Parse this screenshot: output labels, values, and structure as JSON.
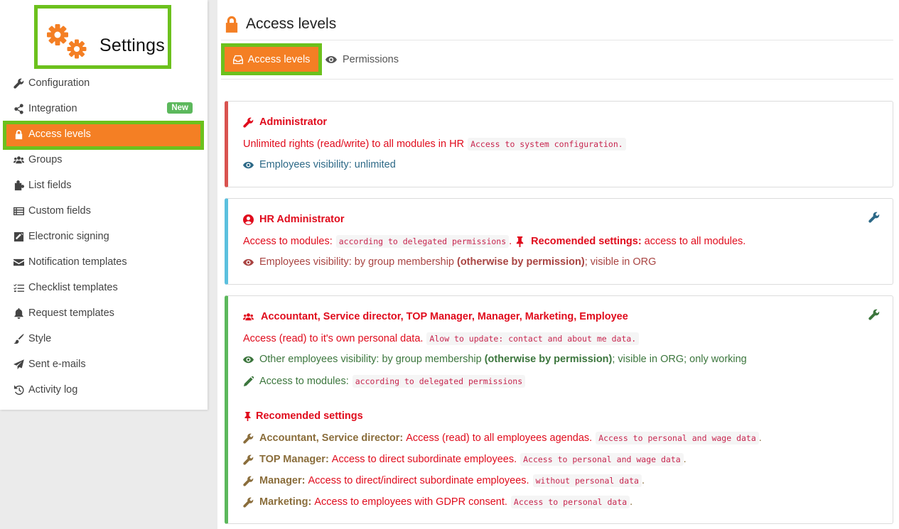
{
  "sidebar": {
    "title": "Settings",
    "items": [
      {
        "label": "Configuration",
        "icon": "wrench-icon"
      },
      {
        "label": "Integration",
        "icon": "share-icon",
        "badge": "New"
      },
      {
        "label": "Access levels",
        "icon": "lock-icon",
        "active": true
      },
      {
        "label": "Groups",
        "icon": "users-icon"
      },
      {
        "label": "List fields",
        "icon": "puzzle-icon"
      },
      {
        "label": "Custom fields",
        "icon": "list-icon"
      },
      {
        "label": "Electronic signing",
        "icon": "signature-icon"
      },
      {
        "label": "Notification templates",
        "icon": "envelope-icon"
      },
      {
        "label": "Checklist templates",
        "icon": "checklist-icon"
      },
      {
        "label": "Request templates",
        "icon": "bell-icon"
      },
      {
        "label": "Style",
        "icon": "brush-icon"
      },
      {
        "label": "Sent e-mails",
        "icon": "paper-plane-icon"
      },
      {
        "label": "Activity log",
        "icon": "history-icon"
      }
    ]
  },
  "page": {
    "title": "Access levels",
    "tabs": [
      {
        "label": "Access levels",
        "icon": "inbox-icon",
        "active": true
      },
      {
        "label": "Permissions",
        "icon": "eye-icon"
      }
    ]
  },
  "cards": {
    "admin": {
      "title": "Administrator",
      "rights": "Unlimited rights (read/write) to all modules in HR",
      "rights_code": "Access to system configuration.",
      "visibility": "Employees visibility: unlimited"
    },
    "hr": {
      "title": "HR Administrator",
      "modules_label": "Access to modules:",
      "modules_code": "according to delegated permissions",
      "modules_sep": ".",
      "rec_label": "Recomended settings:",
      "rec_text": "access to all modules.",
      "vis_text": "Employees visibility: by group membership",
      "vis_bold": "(otherwise by permission)",
      "vis_rest": "; visible in ORG"
    },
    "employee": {
      "title": "Accountant, Service director, TOP Manager, Manager, Marketing, Employee",
      "own_text": "Access (read) to it's own personal data.",
      "own_code": "Alow to update: contact and about me data.",
      "vis_text": "Other employees visibility: by group membership",
      "vis_bold": "(otherwise by permission)",
      "vis_rest": "; visible in ORG; only working",
      "modules_label": "Access to modules:",
      "modules_code": "according to delegated permissions",
      "rec_title": "Recomended settings",
      "recs": [
        {
          "role": "Accountant, Service director:",
          "text": "Access (read) to all employees agendas.",
          "code": "Access to personal and wage data",
          "end": "."
        },
        {
          "role": "TOP Manager:",
          "text": "Access to direct subordinate employees.",
          "code": "Access to personal and wage data",
          "end": "."
        },
        {
          "role": "Manager:",
          "text": "Access to direct/indirect subordinate employees.",
          "code": "without personal data",
          "end": "."
        },
        {
          "role": "Marketing:",
          "text": "Access to employees with GDPR consent.",
          "code": "Access to personal data",
          "end": "."
        }
      ]
    }
  },
  "colors": {
    "accent": "#f47f24",
    "highlight_frame": "#6cc11d",
    "danger_text": "#e00b1c",
    "badge": "#5cb85c"
  }
}
